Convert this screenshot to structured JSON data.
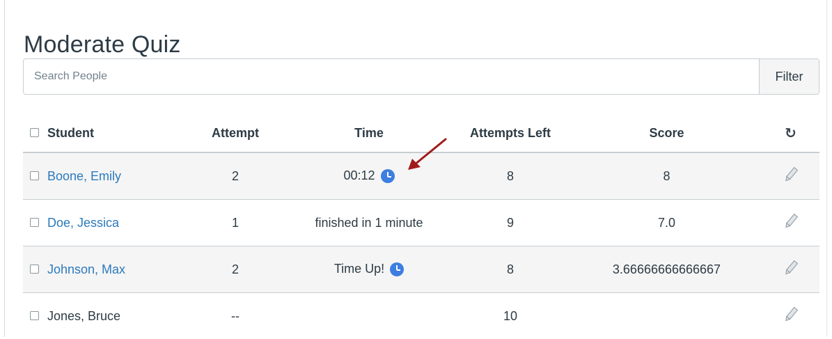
{
  "page": {
    "title": "Moderate Quiz"
  },
  "search": {
    "placeholder": "Search People",
    "filter_label": "Filter"
  },
  "table": {
    "headers": {
      "student": "Student",
      "attempt": "Attempt",
      "time": "Time",
      "attempts_left": "Attempts Left",
      "score": "Score",
      "refresh_icon": "refresh-icon"
    },
    "rows": [
      {
        "student": "Boone, Emily",
        "attempt": "2",
        "time": "00:12",
        "time_icon": "clock-icon",
        "attempts_left": "8",
        "score": "8",
        "linked": true
      },
      {
        "student": "Doe, Jessica",
        "attempt": "1",
        "time": "finished in 1 minute",
        "time_icon": "",
        "attempts_left": "9",
        "score": "7.0",
        "linked": true
      },
      {
        "student": "Johnson, Max",
        "attempt": "2",
        "time": "Time Up!",
        "time_icon": "clock-icon",
        "attempts_left": "8",
        "score": "3.66666666666667",
        "linked": true
      },
      {
        "student": "Jones, Bruce",
        "attempt": "--",
        "time": "",
        "time_icon": "",
        "attempts_left": "10",
        "score": "",
        "linked": false
      }
    ],
    "row_action_icon": "pencil-icon"
  },
  "colors": {
    "link": "#2b7abc",
    "clock": "#3d7ee0",
    "annotation_arrow": "#a11b1b",
    "row_shade": "#f5f5f5"
  }
}
